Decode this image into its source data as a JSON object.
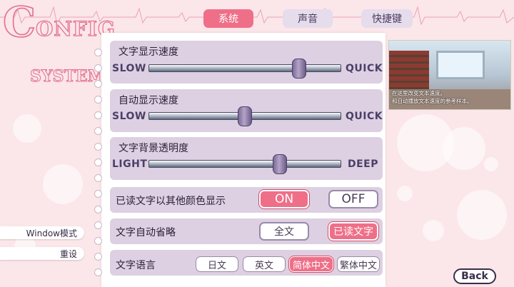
{
  "logo": {
    "big_c": "C",
    "word": "ONFIG",
    "sub": "SYSTEM"
  },
  "tabs": [
    {
      "label": "系统",
      "active": true
    },
    {
      "label": "声音",
      "active": false
    },
    {
      "label": "快捷键",
      "active": false
    }
  ],
  "text_speed": {
    "label": "文字显示速度",
    "min_label": "SLOW",
    "max_label": "QUICK",
    "value": 0.78
  },
  "auto_speed": {
    "label": "自动显示速度",
    "min_label": "SLOW",
    "max_label": "QUICK",
    "value": 0.5
  },
  "opacity": {
    "label": "文字背景透明度",
    "min_label": "LIGHT",
    "max_label": "DEEP",
    "value": 0.68
  },
  "read_color": {
    "label": "已读文字以其他颜色显示",
    "on": "ON",
    "off": "OFF",
    "selected": "on"
  },
  "auto_skip": {
    "label": "文字自动省略",
    "all": "全文",
    "read": "已读文字",
    "selected": "read"
  },
  "language": {
    "label": "文字语言",
    "options": [
      "日文",
      "英文",
      "简体中文",
      "繁体中文"
    ],
    "selected": 2
  },
  "side": {
    "window_mode": "Window模式",
    "reset": "重设"
  },
  "preview": {
    "line1": "在这里改变文本速度。",
    "line2": "和自动播放文本速度的参考样本。"
  },
  "back_label": "Back",
  "colors": {
    "accent": "#ef6f88",
    "panel": "#ddd0e2",
    "background": "#fbe6ea"
  }
}
